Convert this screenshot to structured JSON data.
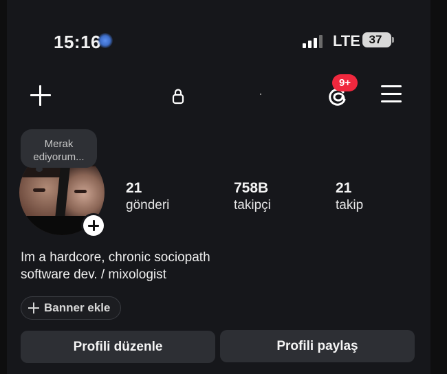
{
  "status_bar": {
    "time": "15:16",
    "network": "LTE",
    "battery": "37"
  },
  "top_bar": {
    "notification_badge": "9+"
  },
  "profile": {
    "note": [
      "Merak",
      "ediyorum..."
    ],
    "stats": [
      {
        "value": "21",
        "label": "gönderi"
      },
      {
        "value": "758B",
        "label": "takipçi"
      },
      {
        "value": "21",
        "label": "takip"
      }
    ],
    "bio": [
      "Im a hardcore, chronic sociopath",
      "software dev. / mixologist"
    ],
    "banner_label": "Banner ekle",
    "edit_label": "Profili düzenle",
    "share_label": "Profili paylaş"
  },
  "colors": {
    "badge": "#f0283e",
    "background": "#16171b",
    "button": "#2d2f34"
  }
}
